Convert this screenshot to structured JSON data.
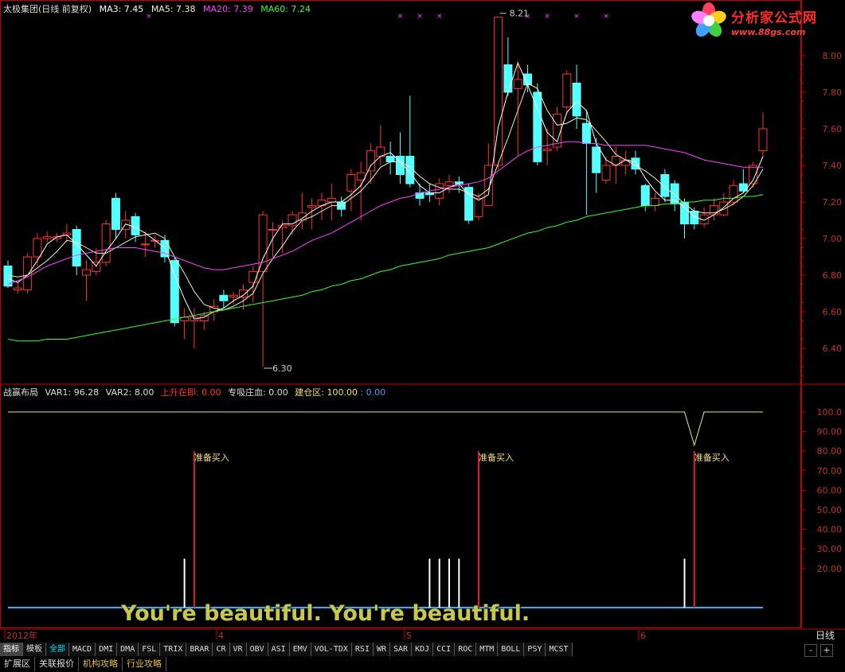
{
  "header": {
    "title": "太极集团(日线 前复权)",
    "ma3": "MA3: 7.45",
    "ma5": "MA5: 7.38",
    "ma20": "MA20: 7.39",
    "ma60": "MA60: 7.24"
  },
  "indicator_header": {
    "name": "战赢布局",
    "var1": "VAR1: 96.28",
    "var2": "VAR2: 8.00",
    "rise": "上升在即: 0.00",
    "absorb": "专吸庄血: 0.00",
    "build": "建仓区: 100.00",
    "extra": ": 0.00"
  },
  "colors": {
    "up": "#ff3030",
    "down": "#54ffff",
    "ma3": "#ffffff",
    "ma5": "#f0f0c0",
    "ma20": "#ff40ff",
    "ma60": "#30ff30",
    "grid": "#800000",
    "axis": "#c00000"
  },
  "logo": {
    "title": "分析家公式网",
    "url": "www.88gs.com"
  },
  "chart_data": [
    {
      "type": "candlestick",
      "y_ticks": [
        "8.00",
        "7.80",
        "7.60",
        "7.40",
        "7.20",
        "7.00",
        "6.80",
        "6.60",
        "6.40"
      ],
      "ylim": [
        6.3,
        8.3
      ],
      "annotations": {
        "high": "8.21",
        "low": "6.30"
      },
      "x_labels": [
        "2012年",
        "4",
        "5",
        "6"
      ],
      "candles": [
        [
          6.85,
          6.74,
          6.88,
          6.73
        ],
        [
          6.72,
          6.73,
          6.76,
          6.7
        ],
        [
          6.72,
          6.9,
          6.92,
          6.7
        ],
        [
          6.9,
          7.0,
          7.03,
          6.85
        ],
        [
          7.0,
          7.01,
          7.04,
          6.98
        ],
        [
          7.0,
          7.01,
          7.03,
          6.98
        ],
        [
          7.02,
          7.03,
          7.08,
          6.98
        ],
        [
          7.05,
          6.85,
          7.07,
          6.8
        ],
        [
          6.8,
          6.83,
          6.88,
          6.66
        ],
        [
          6.82,
          6.87,
          6.95,
          6.8
        ],
        [
          6.87,
          7.08,
          7.1,
          6.85
        ],
        [
          7.22,
          7.05,
          7.25,
          7.0
        ],
        [
          7.05,
          7.1,
          7.15,
          7.0
        ],
        [
          7.12,
          7.02,
          7.14,
          6.98
        ],
        [
          6.97,
          6.97,
          7.04,
          6.9
        ],
        [
          6.99,
          6.99,
          7.02,
          6.95
        ],
        [
          6.99,
          6.9,
          7.02,
          6.87
        ],
        [
          6.88,
          6.54,
          6.9,
          6.52
        ],
        [
          6.55,
          6.57,
          6.62,
          6.45
        ],
        [
          6.55,
          6.57,
          6.62,
          6.4
        ],
        [
          6.55,
          6.58,
          6.6,
          6.5
        ],
        [
          6.6,
          6.63,
          6.67,
          6.55
        ],
        [
          6.69,
          6.66,
          6.72,
          6.62
        ],
        [
          6.68,
          6.69,
          6.71,
          6.64
        ],
        [
          6.68,
          6.72,
          6.75,
          6.61
        ],
        [
          6.76,
          6.82,
          6.85,
          6.65
        ],
        [
          6.82,
          7.13,
          7.15,
          6.3
        ],
        [
          7.05,
          7.05,
          7.09,
          6.9
        ],
        [
          7.06,
          7.07,
          7.1,
          6.92
        ],
        [
          7.07,
          7.13,
          7.15,
          7.02
        ],
        [
          7.1,
          7.14,
          7.25,
          7.05
        ],
        [
          7.17,
          7.18,
          7.22,
          7.05
        ],
        [
          7.18,
          7.21,
          7.25,
          7.1
        ],
        [
          7.2,
          7.22,
          7.3,
          7.1
        ],
        [
          7.2,
          7.16,
          7.23,
          7.12
        ],
        [
          7.26,
          7.35,
          7.38,
          7.15
        ],
        [
          7.32,
          7.36,
          7.42,
          7.1
        ],
        [
          7.37,
          7.48,
          7.52,
          7.3
        ],
        [
          7.45,
          7.5,
          7.62,
          7.4
        ],
        [
          7.45,
          7.42,
          7.53,
          7.35
        ],
        [
          7.45,
          7.35,
          7.58,
          7.3
        ],
        [
          7.45,
          7.3,
          7.78,
          7.28
        ],
        [
          7.25,
          7.22,
          7.3,
          7.18
        ],
        [
          7.25,
          7.24,
          7.3,
          7.2
        ],
        [
          7.22,
          7.3,
          7.33,
          7.18
        ],
        [
          7.29,
          7.31,
          7.35,
          7.25
        ],
        [
          7.31,
          7.3,
          7.34,
          7.25
        ],
        [
          7.28,
          7.1,
          7.3,
          7.08
        ],
        [
          7.12,
          7.22,
          7.25,
          7.1
        ],
        [
          7.18,
          7.4,
          7.52,
          7.18
        ],
        [
          7.4,
          8.21,
          8.21,
          7.38
        ],
        [
          7.95,
          7.8,
          8.1,
          7.78
        ],
        [
          7.82,
          7.87,
          7.97,
          7.45
        ],
        [
          7.9,
          7.84,
          7.95,
          7.8
        ],
        [
          7.8,
          7.42,
          7.85,
          7.4
        ],
        [
          7.48,
          7.49,
          7.6,
          7.4
        ],
        [
          7.5,
          7.68,
          7.72,
          7.48
        ],
        [
          7.72,
          7.9,
          7.92,
          7.68
        ],
        [
          7.85,
          7.67,
          7.95,
          7.6
        ],
        [
          7.63,
          7.52,
          7.7,
          7.13
        ],
        [
          7.5,
          7.36,
          7.55,
          7.25
        ],
        [
          7.32,
          7.4,
          7.45,
          7.3
        ],
        [
          7.4,
          7.45,
          7.5,
          7.3
        ],
        [
          7.4,
          7.43,
          7.48,
          7.35
        ],
        [
          7.44,
          7.38,
          7.48,
          7.35
        ],
        [
          7.29,
          7.18,
          7.3,
          7.15
        ],
        [
          7.18,
          7.22,
          7.25,
          7.15
        ],
        [
          7.35,
          7.23,
          7.38,
          7.2
        ],
        [
          7.3,
          7.19,
          7.32,
          7.15
        ],
        [
          7.2,
          7.08,
          7.22,
          7.0
        ],
        [
          7.15,
          7.08,
          7.17,
          7.05
        ],
        [
          7.08,
          7.13,
          7.17,
          7.06
        ],
        [
          7.13,
          7.18,
          7.22,
          7.1
        ],
        [
          7.13,
          7.2,
          7.25,
          7.12
        ],
        [
          7.2,
          7.29,
          7.32,
          7.18
        ],
        [
          7.3,
          7.26,
          7.38,
          7.25
        ],
        [
          7.3,
          7.4,
          7.42,
          7.28
        ],
        [
          7.48,
          7.6,
          7.69,
          7.45
        ]
      ],
      "ma_series": [
        {
          "name": "MA3",
          "values": [
            6.78,
            6.76,
            6.8,
            6.88,
            6.97,
            7.01,
            7.02,
            6.97,
            6.91,
            6.85,
            6.93,
            7.0,
            7.08,
            7.06,
            7.03,
            6.99,
            6.95,
            6.8,
            6.67,
            6.56,
            6.57,
            6.6,
            6.62,
            6.66,
            6.69,
            6.74,
            6.89,
            7.0,
            7.08,
            7.08,
            7.11,
            7.15,
            7.18,
            7.2,
            7.2,
            7.24,
            7.29,
            7.4,
            7.45,
            7.47,
            7.42,
            7.36,
            7.29,
            7.25,
            7.25,
            7.28,
            7.3,
            7.24,
            7.21,
            7.24,
            7.61,
            7.8,
            7.96,
            7.84,
            7.71,
            7.58,
            7.53,
            7.69,
            7.75,
            7.7,
            7.52,
            7.43,
            7.4,
            7.43,
            7.42,
            7.33,
            7.26,
            7.21,
            7.21,
            7.17,
            7.12,
            7.1,
            7.13,
            7.17,
            7.22,
            7.25,
            7.32,
            7.45
          ]
        },
        {
          "name": "MA5",
          "values": [
            6.8,
            6.79,
            6.8,
            6.84,
            6.88,
            6.93,
            6.99,
            6.98,
            6.95,
            6.92,
            6.92,
            6.95,
            6.98,
            7.01,
            7.02,
            7.03,
            7.0,
            6.9,
            6.81,
            6.71,
            6.64,
            6.62,
            6.61,
            6.63,
            6.66,
            6.7,
            6.81,
            6.89,
            6.96,
            7.04,
            7.1,
            7.12,
            7.15,
            7.18,
            7.18,
            7.22,
            7.26,
            7.32,
            7.39,
            7.42,
            7.42,
            7.39,
            7.34,
            7.3,
            7.28,
            7.27,
            7.27,
            7.25,
            7.23,
            7.27,
            7.41,
            7.55,
            7.7,
            7.85,
            7.82,
            7.7,
            7.62,
            7.63,
            7.66,
            7.65,
            7.59,
            7.53,
            7.46,
            7.43,
            7.4,
            7.37,
            7.33,
            7.28,
            7.24,
            7.19,
            7.15,
            7.14,
            7.14,
            7.16,
            7.19,
            7.23,
            7.29,
            7.38
          ]
        },
        {
          "name": "MA20",
          "values": [
            6.75,
            6.77,
            6.79,
            6.82,
            6.85,
            6.87,
            6.89,
            6.91,
            6.92,
            6.93,
            6.94,
            6.95,
            6.95,
            6.95,
            6.94,
            6.93,
            6.92,
            6.9,
            6.88,
            6.86,
            6.84,
            6.83,
            6.83,
            6.84,
            6.85,
            6.86,
            6.87,
            6.89,
            6.91,
            6.93,
            6.96,
            6.99,
            7.01,
            7.03,
            7.06,
            7.09,
            7.12,
            7.15,
            7.18,
            7.2,
            7.22,
            7.23,
            7.25,
            7.26,
            7.27,
            7.28,
            7.29,
            7.3,
            7.31,
            7.33,
            7.37,
            7.41,
            7.45,
            7.48,
            7.5,
            7.51,
            7.52,
            7.53,
            7.53,
            7.52,
            7.52,
            7.51,
            7.51,
            7.51,
            7.51,
            7.51,
            7.5,
            7.49,
            7.48,
            7.47,
            7.45,
            7.43,
            7.42,
            7.41,
            7.4,
            7.39,
            7.39,
            7.39
          ]
        },
        {
          "name": "MA60",
          "values": [
            6.45,
            6.44,
            6.44,
            6.44,
            6.45,
            6.45,
            6.45,
            6.46,
            6.47,
            6.48,
            6.49,
            6.5,
            6.51,
            6.52,
            6.53,
            6.54,
            6.55,
            6.56,
            6.57,
            6.58,
            6.59,
            6.6,
            6.61,
            6.62,
            6.63,
            6.64,
            6.65,
            6.66,
            6.67,
            6.68,
            6.69,
            6.71,
            6.72,
            6.74,
            6.75,
            6.77,
            6.78,
            6.8,
            6.82,
            6.83,
            6.85,
            6.86,
            6.87,
            6.88,
            6.89,
            6.91,
            6.92,
            6.93,
            6.94,
            6.95,
            6.97,
            6.99,
            7.01,
            7.03,
            7.04,
            7.06,
            7.07,
            7.09,
            7.1,
            7.12,
            7.13,
            7.14,
            7.15,
            7.16,
            7.17,
            7.18,
            7.18,
            7.19,
            7.19,
            7.2,
            7.2,
            7.21,
            7.21,
            7.22,
            7.22,
            7.23,
            7.23,
            7.24
          ]
        }
      ],
      "ytick_label_dates_note": ""
    },
    {
      "type": "indicator",
      "y_ticks": [
        "100.0",
        "90.00",
        "80.00",
        "70.00",
        "60.00",
        "50.00",
        "40.00",
        "30.00",
        "20.00"
      ],
      "ylim": [
        0,
        112
      ],
      "line_values": [
        100,
        100,
        100,
        100,
        100,
        100,
        100,
        100,
        100,
        100,
        100,
        100,
        100,
        100,
        100,
        100,
        100,
        100,
        100,
        100,
        100,
        100,
        100,
        100,
        100,
        100,
        100,
        100,
        100,
        100,
        100,
        100,
        100,
        100,
        100,
        100,
        100,
        100,
        100,
        100,
        100,
        100,
        100,
        100,
        100,
        100,
        100,
        100,
        100,
        100,
        100,
        100,
        100,
        100,
        100,
        100,
        100,
        100,
        100,
        100,
        100,
        100,
        100,
        100,
        100,
        100,
        100,
        100,
        100,
        100,
        83,
        100,
        100,
        100,
        100,
        100,
        100,
        100
      ],
      "white_bars": [
        {
          "i": 18,
          "v": 25
        },
        {
          "i": 43,
          "v": 25
        },
        {
          "i": 44,
          "v": 25
        },
        {
          "i": 45,
          "v": 25
        },
        {
          "i": 46,
          "v": 25
        },
        {
          "i": 69,
          "v": 25
        }
      ],
      "signals": [
        {
          "i": 19,
          "v": 80,
          "label": "准备买入"
        },
        {
          "i": 48,
          "v": 80,
          "label": "准备买入"
        },
        {
          "i": 70,
          "v": 80,
          "label": "准备买入"
        }
      ]
    }
  ],
  "subtitle": "You're beautiful. You're beautiful.",
  "period_button": "日线",
  "controls": {
    "minus": "-",
    "plus": "+"
  },
  "tabs": [
    "指标",
    "模板",
    "全部",
    "MACD",
    "DMI",
    "DMA",
    "FSL",
    "TRIX",
    "BRAR",
    "CR",
    "VR",
    "OBV",
    "ASI",
    "EMV",
    "VOL-TDX",
    "RSI",
    "WR",
    "SAR",
    "KDJ",
    "CCI",
    "ROC",
    "MTM",
    "BOLL",
    "PSY",
    "MCST"
  ],
  "tabs2": [
    "扩展区",
    "关联报价",
    "机构攻略",
    "行业攻略"
  ]
}
